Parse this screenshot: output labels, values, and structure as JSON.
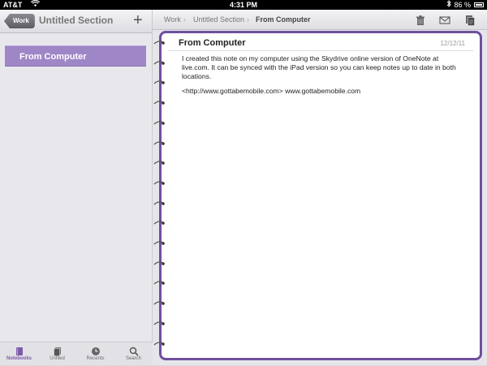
{
  "status_bar": {
    "carrier": "AT&T",
    "time": "4:31 PM",
    "battery": "86 %"
  },
  "left_panel": {
    "back_label": "Work",
    "title": "Untitled Section",
    "add_symbol": "+",
    "items": [
      {
        "label": "From Computer",
        "selected": true
      }
    ]
  },
  "tab_bar": {
    "tabs": [
      {
        "label": "Notebooks",
        "icon": "notebook-icon",
        "active": true
      },
      {
        "label": "Unfiled",
        "icon": "pages-icon",
        "active": false
      },
      {
        "label": "Recents",
        "icon": "clock-icon",
        "active": false
      },
      {
        "label": "Search",
        "icon": "search-icon",
        "active": false
      }
    ]
  },
  "breadcrumb": {
    "items": [
      "Work",
      "Untitled Section",
      "From Computer"
    ]
  },
  "toolbar": {
    "icons": [
      "trash-icon",
      "mail-icon",
      "page-icon"
    ]
  },
  "note": {
    "title": "From Computer",
    "date": "12/12/11",
    "paragraphs": [
      "I created this note on my computer using the Skydrive online version of OneNote at live.com. It can be synced with the iPad version so you can keep notes up to date in both locations.",
      "<http://www.gottabemobile.com> www.gottabemobile.com"
    ]
  },
  "colors": {
    "accent": "#7c5aa8",
    "selection": "#9f86c6",
    "page_border": "#6f4f9d"
  }
}
